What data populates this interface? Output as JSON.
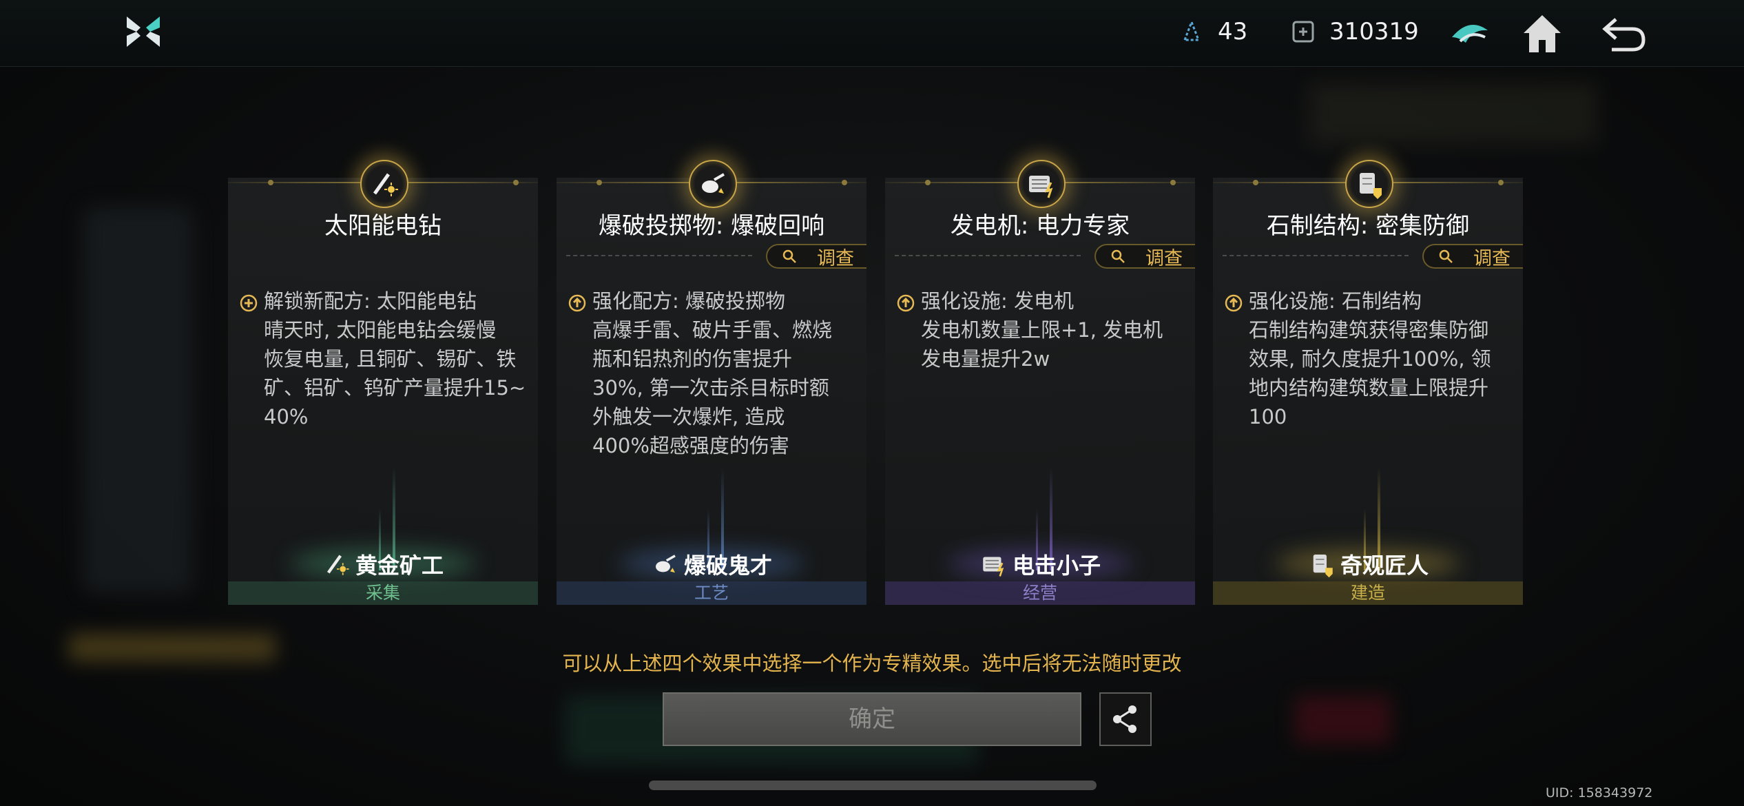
{
  "resources": [
    {
      "icon": "crystal-icon",
      "value": "43"
    },
    {
      "icon": "chip-icon",
      "value": "310319"
    }
  ],
  "topbar_icons": [
    "faction-emblem-icon",
    "home-icon",
    "back-icon"
  ],
  "cards": [
    {
      "title": "太阳能电钻",
      "inspect": null,
      "desc_icon": "plus-icon",
      "lines": [
        "解锁新配方: 太阳能电钻",
        "晴天时, 太阳能电钻会缓慢",
        "恢复电量, 且铜矿、锡矿、铁",
        "矿、铝矿、钨矿产量提升15~",
        "40%"
      ],
      "role": "黄金矿工",
      "category": "采集",
      "medal_icon": "solar-drill-icon",
      "color": "#6fbf8f"
    },
    {
      "title": "爆破投掷物: 爆破回响",
      "inspect": "调查",
      "desc_icon": "upgrade-icon",
      "lines": [
        "强化配方: 爆破投掷物",
        "高爆手雷、破片手雷、燃烧",
        "瓶和铝热剂的伤害提升",
        "30%, 第一次击杀目标时额",
        "外触发一次爆炸, 造成",
        "400%超感强度的伤害"
      ],
      "role": "爆破鬼才",
      "category": "工艺",
      "medal_icon": "grenade-icon",
      "color": "#6d8bc4"
    },
    {
      "title": "发电机: 电力专家",
      "inspect": "调查",
      "desc_icon": "upgrade-icon",
      "lines": [
        "强化设施: 发电机",
        "发电机数量上限+1, 发电机",
        "发电量提升2w"
      ],
      "role": "电击小子",
      "category": "经营",
      "medal_icon": "generator-icon",
      "color": "#8f7fc8"
    },
    {
      "title": "石制结构: 密集防御",
      "inspect": "调查",
      "desc_icon": "upgrade-icon",
      "lines": [
        "强化设施: 石制结构",
        "石制结构建筑获得密集防御",
        "效果, 耐久度提升100%, 领",
        "地内结构建筑数量上限提升",
        "100"
      ],
      "role": "奇观匠人",
      "category": "建造",
      "medal_icon": "stone-structure-icon",
      "color": "#c8b04a"
    }
  ],
  "hint": "可以从上述四个效果中选择一个作为专精效果。选中后将无法随时更改",
  "confirm_label": "确定",
  "uid": "UID: 158343972"
}
